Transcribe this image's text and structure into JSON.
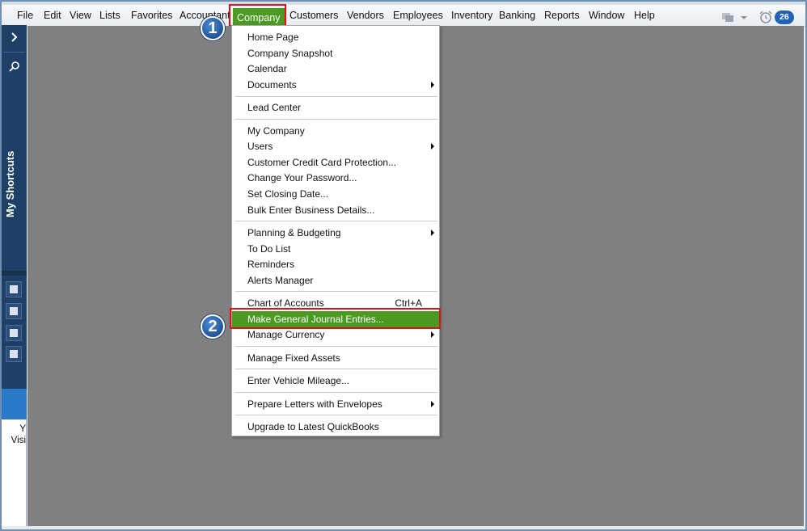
{
  "menubar": {
    "items": [
      "File",
      "Edit",
      "View",
      "Lists",
      "Favorites",
      "Accountant",
      "Company",
      "Customers",
      "Vendors",
      "Employees",
      "Inventory",
      "Banking",
      "Reports",
      "Window",
      "Help"
    ],
    "active": "Company",
    "accent_color": "#4b9a22",
    "reminder_count": "26"
  },
  "sidebar": {
    "title": "My Shortcuts",
    "expand_icon": "chevron-right-icon",
    "search_icon": "search-icon",
    "footer_line1": "Y",
    "footer_line2": "Visi"
  },
  "company_menu": {
    "groups": [
      [
        "Home Page",
        "Company Snapshot",
        "Calendar",
        "Documents"
      ],
      [
        "Lead Center"
      ],
      [
        "My Company",
        "Users",
        "Customer Credit Card Protection...",
        "Change Your Password...",
        "Set Closing Date...",
        "Bulk Enter Business Details..."
      ],
      [
        "Planning & Budgeting",
        "To Do List",
        "Reminders",
        "Alerts Manager"
      ],
      [
        "Chart of Accounts",
        "Make General Journal Entries...",
        "Manage Currency"
      ],
      [
        "Manage Fixed Assets"
      ],
      [
        "Enter Vehicle Mileage..."
      ],
      [
        "Prepare Letters with Envelopes"
      ],
      [
        "Upgrade to Latest QuickBooks"
      ]
    ],
    "chart_of_accounts_shortcut": "Ctrl+A",
    "highlighted": "Make General Journal Entries..."
  },
  "annotations": {
    "step1": "1",
    "step2": "2",
    "highlight_color": "#e0101a"
  }
}
